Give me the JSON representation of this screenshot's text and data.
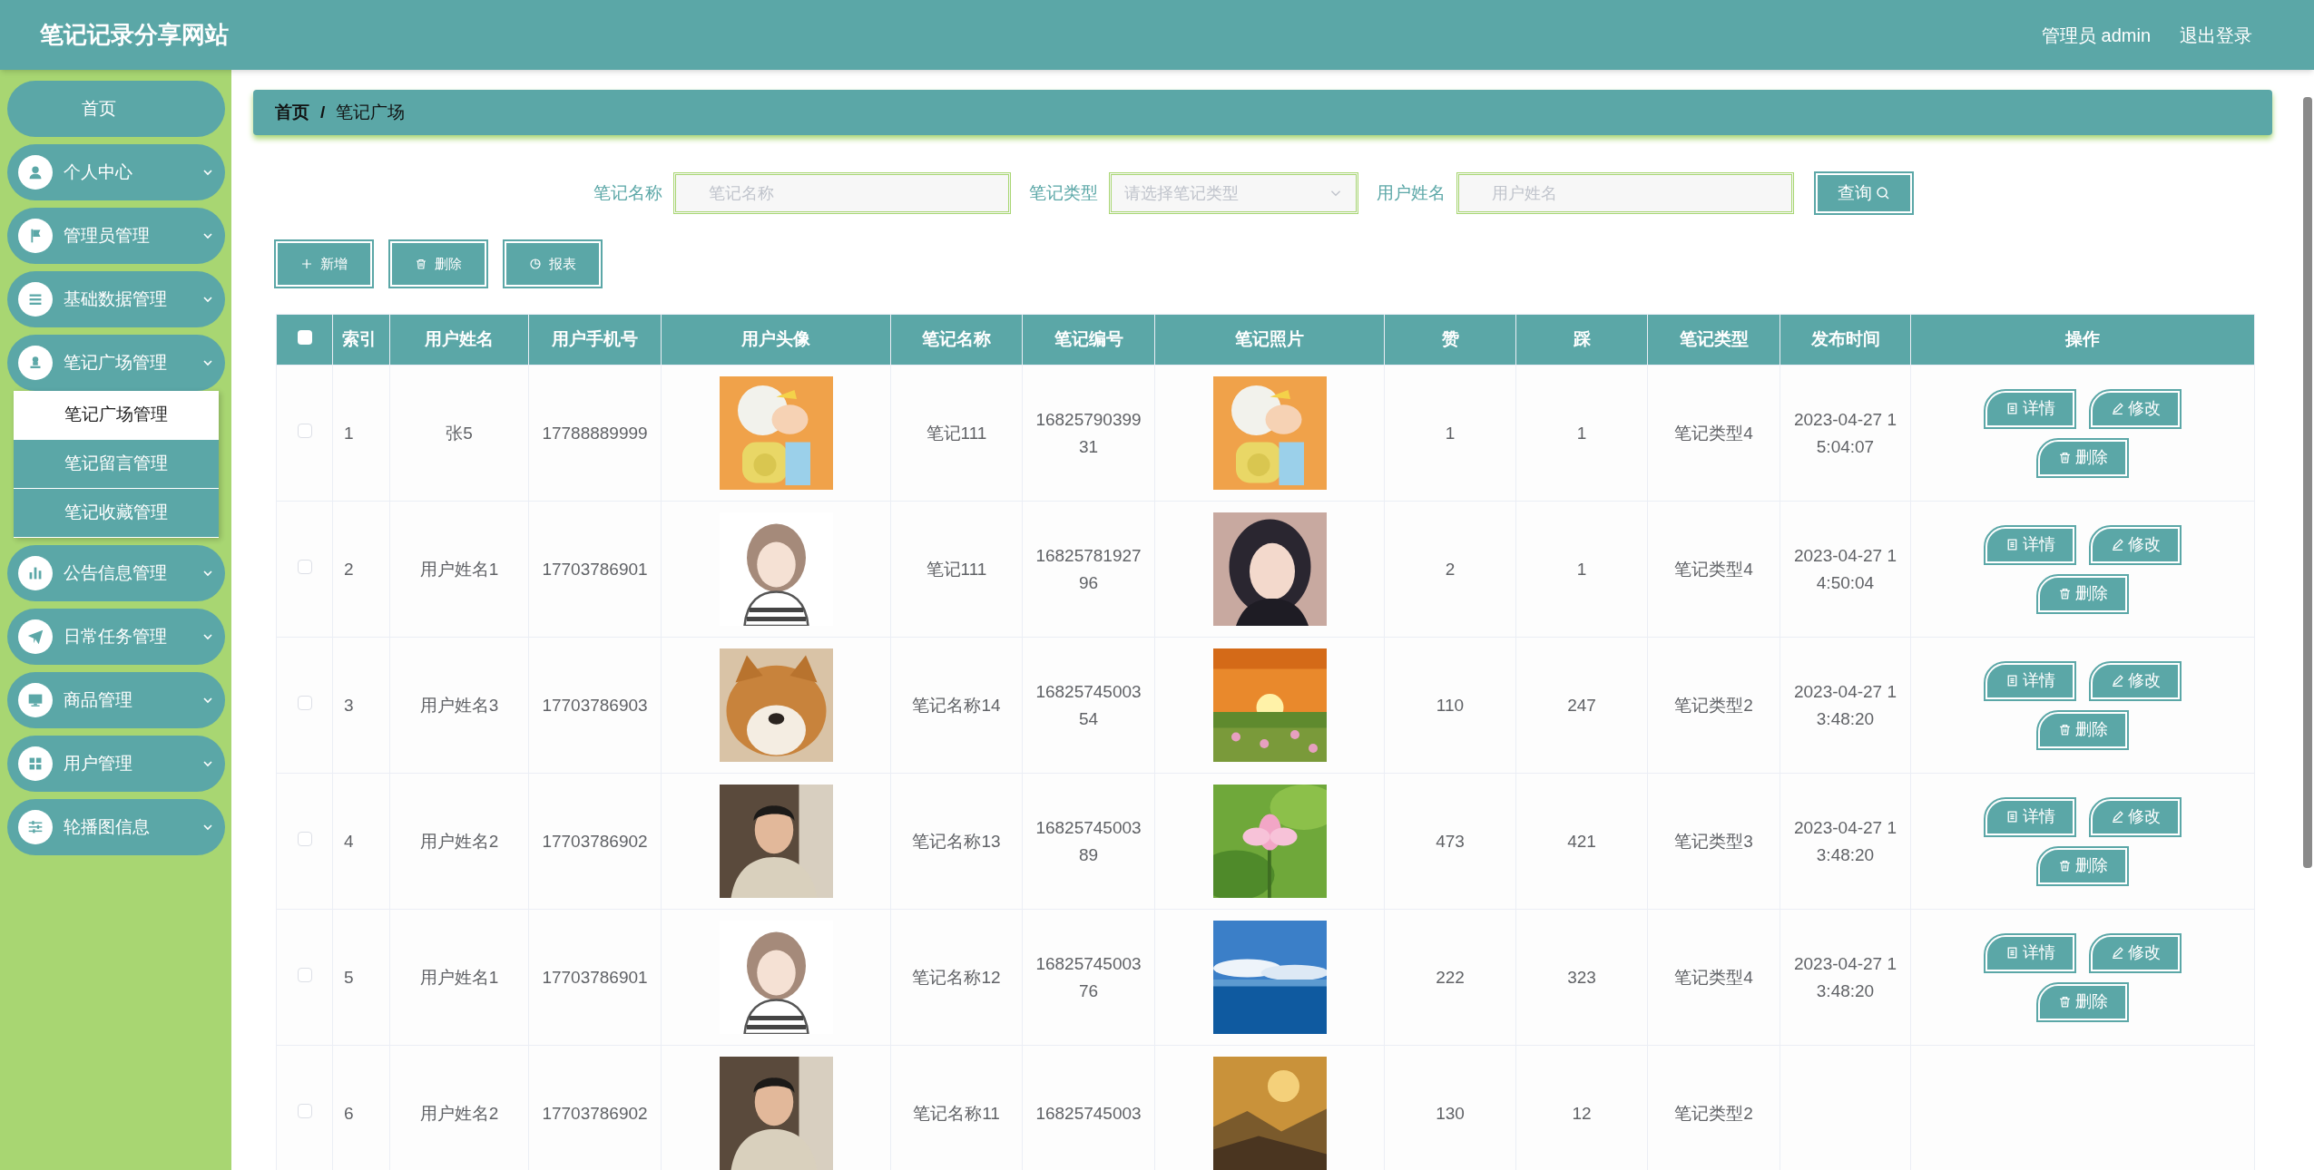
{
  "header": {
    "title": "笔记记录分享网站",
    "user": "管理员 admin",
    "logout": "退出登录"
  },
  "sidebar": {
    "items": [
      {
        "kind": "link",
        "label": "首页"
      },
      {
        "kind": "menu",
        "label": "个人中心"
      },
      {
        "kind": "menu",
        "label": "管理员管理"
      },
      {
        "kind": "menu",
        "label": "基础数据管理"
      },
      {
        "kind": "menu",
        "label": "笔记广场管理",
        "children": [
          {
            "label": "笔记广场管理",
            "selected": true
          },
          {
            "label": "笔记留言管理",
            "selected": false
          },
          {
            "label": "笔记收藏管理",
            "selected": false
          }
        ]
      },
      {
        "kind": "menu",
        "label": "公告信息管理"
      },
      {
        "kind": "menu",
        "label": "日常任务管理"
      },
      {
        "kind": "menu",
        "label": "商品管理"
      },
      {
        "kind": "menu",
        "label": "用户管理"
      },
      {
        "kind": "menu",
        "label": "轮播图信息"
      }
    ]
  },
  "breadcrumb": {
    "items": [
      "首页",
      "笔记广场"
    ],
    "separator": "/"
  },
  "search": {
    "fields": [
      {
        "kind": "input",
        "label": "笔记名称",
        "placeholder": "笔记名称"
      },
      {
        "kind": "select",
        "label": "笔记类型",
        "placeholder": "请选择笔记类型"
      },
      {
        "kind": "input",
        "label": "用户姓名",
        "placeholder": "用户姓名"
      }
    ],
    "button": "查询"
  },
  "toolbar": [
    "新增",
    "删除",
    "报表"
  ],
  "table": {
    "select_all_checked": false,
    "columns": [
      "索引",
      "用户姓名",
      "用户手机号",
      "用户头像",
      "笔记名称",
      "笔记编号",
      "笔记照片",
      "赞",
      "踩",
      "笔记类型",
      "发布时间",
      "操作"
    ],
    "rows": [
      {
        "checked": false,
        "index": "1",
        "user_name": "张5",
        "phone": "17788889999",
        "note_name": "笔记111",
        "note_no": "1682579039931",
        "likes": "1",
        "dislikes": "1",
        "type": "笔记类型4",
        "time": "2023-04-27 15:04:07",
        "actions": [
          "详情",
          "修改",
          "删除"
        ]
      },
      {
        "checked": false,
        "index": "2",
        "user_name": "用户姓名1",
        "phone": "17703786901",
        "note_name": "笔记111",
        "note_no": "1682578192796",
        "likes": "2",
        "dislikes": "1",
        "type": "笔记类型4",
        "time": "2023-04-27 14:50:04",
        "actions": [
          "详情",
          "修改",
          "删除"
        ]
      },
      {
        "checked": false,
        "index": "3",
        "user_name": "用户姓名3",
        "phone": "17703786903",
        "note_name": "笔记名称14",
        "note_no": "1682574500354",
        "likes": "110",
        "dislikes": "247",
        "type": "笔记类型2",
        "time": "2023-04-27 13:48:20",
        "actions": [
          "详情",
          "修改",
          "删除"
        ]
      },
      {
        "checked": false,
        "index": "4",
        "user_name": "用户姓名2",
        "phone": "17703786902",
        "note_name": "笔记名称13",
        "note_no": "1682574500389",
        "likes": "473",
        "dislikes": "421",
        "type": "笔记类型3",
        "time": "2023-04-27 13:48:20",
        "actions": [
          "详情",
          "修改",
          "删除"
        ]
      },
      {
        "checked": false,
        "index": "5",
        "user_name": "用户姓名1",
        "phone": "17703786901",
        "note_name": "笔记名称12",
        "note_no": "1682574500376",
        "likes": "222",
        "dislikes": "323",
        "type": "笔记类型4",
        "time": "2023-04-27 13:48:20",
        "actions": [
          "详情",
          "修改",
          "删除"
        ]
      },
      {
        "checked": false,
        "index": "6",
        "user_name": "用户姓名2",
        "phone": "17703786902",
        "note_name": "笔记名称11",
        "note_no": "16825745003",
        "likes": "130",
        "dislikes": "12",
        "type": "笔记类型2"
      }
    ]
  }
}
